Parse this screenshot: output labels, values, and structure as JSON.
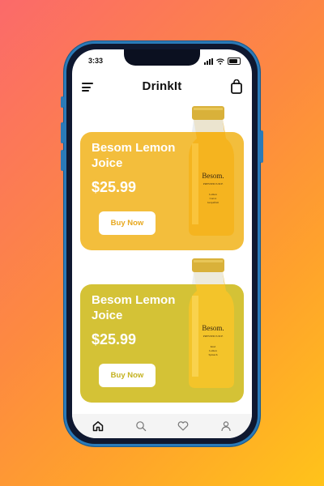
{
  "status_bar": {
    "time": "3:33"
  },
  "header": {
    "title": "DrinkIt"
  },
  "products": [
    {
      "name": "Besom Lemon Joice",
      "price": "$25.99",
      "buy_label": "Buy Now",
      "label": {
        "brand": "Besom.",
        "line": "PRESSED JUICE",
        "ingredients": [
          "Lemon",
          "Carrot",
          "Grapefruit"
        ]
      }
    },
    {
      "name": "Besom Lemon Joice",
      "price": "$25.99",
      "buy_label": "Buy Now",
      "label": {
        "brand": "Besom.",
        "line": "PRESSED JUICE",
        "ingredients": [
          "Kiwi",
          "Lemon",
          "Spinach"
        ]
      }
    }
  ],
  "tab_bar": {
    "items": [
      "home-icon",
      "search-icon",
      "heart-icon",
      "profile-icon"
    ],
    "active": "home-icon"
  },
  "colors": {
    "card1": "#f3be3c",
    "card2": "#d4c236",
    "accent1": "#e7a81f",
    "accent2": "#c4b220"
  }
}
